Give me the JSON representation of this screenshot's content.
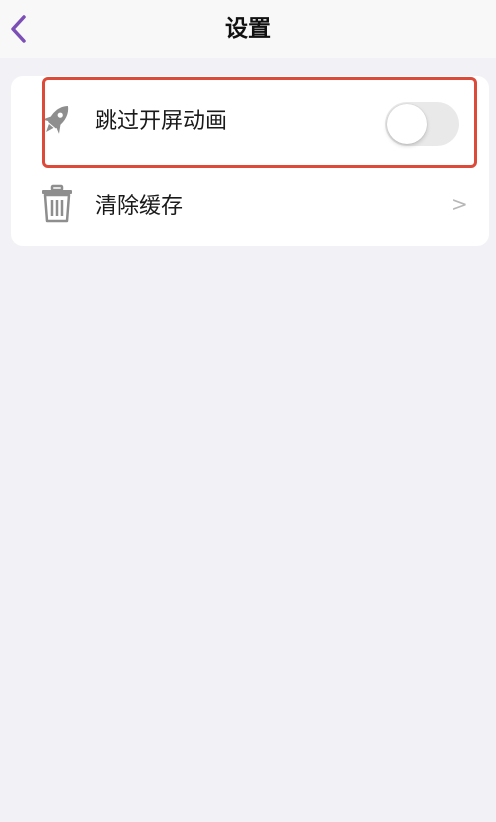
{
  "nav": {
    "title": "设置",
    "accent_color": "#7b4fb5"
  },
  "settings": [
    {
      "label": "跳过开屏动画",
      "icon": "rocket-icon",
      "control": "toggle",
      "enabled": false
    },
    {
      "label": "清除缓存",
      "icon": "trash-icon",
      "control": "chevron"
    }
  ],
  "chevron_glyph": ">",
  "highlight_color": "#dc4a3a"
}
